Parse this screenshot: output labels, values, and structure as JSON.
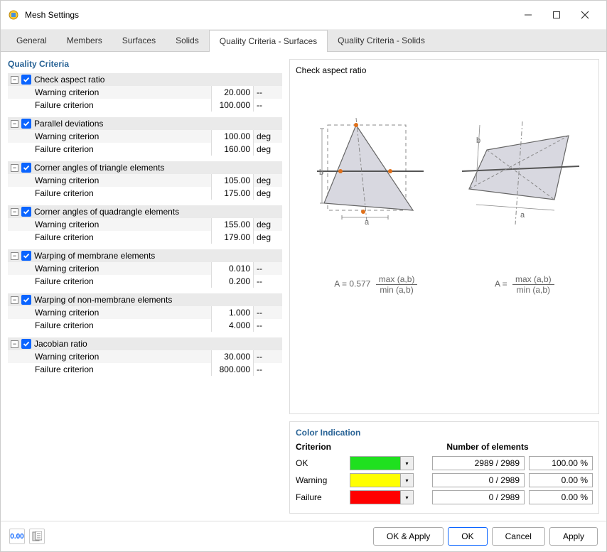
{
  "window": {
    "title": "Mesh Settings"
  },
  "tabs": [
    "General",
    "Members",
    "Surfaces",
    "Solids",
    "Quality Criteria - Surfaces",
    "Quality Criteria - Solids"
  ],
  "active_tab": 4,
  "section_heading": "Quality Criteria",
  "criteria": [
    {
      "label": "Check aspect ratio",
      "rows": [
        {
          "name": "Warning criterion",
          "value": "20.000",
          "unit": "--"
        },
        {
          "name": "Failure criterion",
          "value": "100.000",
          "unit": "--"
        }
      ]
    },
    {
      "label": "Parallel deviations",
      "rows": [
        {
          "name": "Warning criterion",
          "value": "100.00",
          "unit": "deg"
        },
        {
          "name": "Failure criterion",
          "value": "160.00",
          "unit": "deg"
        }
      ]
    },
    {
      "label": "Corner angles of triangle elements",
      "rows": [
        {
          "name": "Warning criterion",
          "value": "105.00",
          "unit": "deg"
        },
        {
          "name": "Failure criterion",
          "value": "175.00",
          "unit": "deg"
        }
      ]
    },
    {
      "label": "Corner angles of quadrangle elements",
      "rows": [
        {
          "name": "Warning criterion",
          "value": "155.00",
          "unit": "deg"
        },
        {
          "name": "Failure criterion",
          "value": "179.00",
          "unit": "deg"
        }
      ]
    },
    {
      "label": "Warping of membrane elements",
      "rows": [
        {
          "name": "Warning criterion",
          "value": "0.010",
          "unit": "--"
        },
        {
          "name": "Failure criterion",
          "value": "0.200",
          "unit": "--"
        }
      ]
    },
    {
      "label": "Warping of non-membrane elements",
      "rows": [
        {
          "name": "Warning criterion",
          "value": "1.000",
          "unit": "--"
        },
        {
          "name": "Failure criterion",
          "value": "4.000",
          "unit": "--"
        }
      ]
    },
    {
      "label": "Jacobian ratio",
      "rows": [
        {
          "name": "Warning criterion",
          "value": "30.000",
          "unit": "--"
        },
        {
          "name": "Failure criterion",
          "value": "800.000",
          "unit": "--"
        }
      ]
    }
  ],
  "preview": {
    "title": "Check aspect ratio",
    "formula1_prefix": "A = 0.577",
    "formula2_prefix": "A =",
    "num": "max (a,b)",
    "den": "min (a,b)",
    "label_a": "a",
    "label_b": "b"
  },
  "color": {
    "heading": "Color Indication",
    "header_criterion": "Criterion",
    "header_elements": "Number of elements",
    "rows": [
      {
        "label": "OK",
        "color": "#1fe01f",
        "count": "2989 / 2989",
        "pct": "100.00 %"
      },
      {
        "label": "Warning",
        "color": "#ffff00",
        "count": "0 / 2989",
        "pct": "0.00 %"
      },
      {
        "label": "Failure",
        "color": "#ff0000",
        "count": "0 / 2989",
        "pct": "0.00 %"
      }
    ]
  },
  "footer": {
    "ok_apply": "OK & Apply",
    "ok": "OK",
    "cancel": "Cancel",
    "apply": "Apply",
    "tool1": "0.00"
  }
}
